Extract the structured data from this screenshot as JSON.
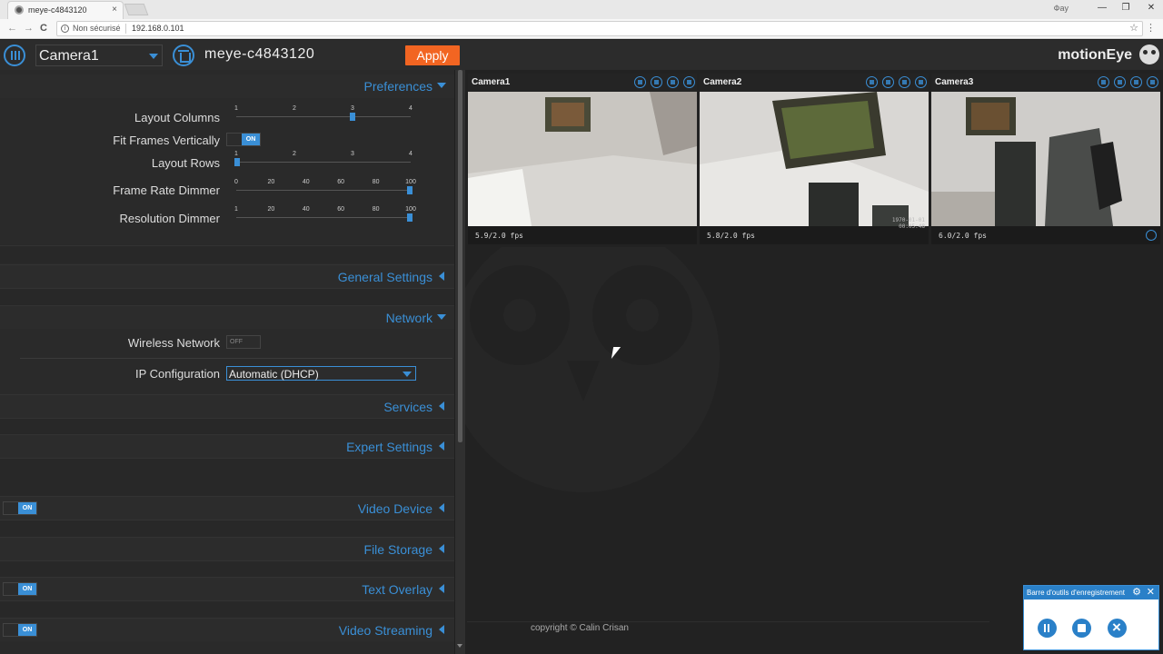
{
  "browser": {
    "tab_title": "meye-c4843120",
    "tab_close": "×",
    "user_badge": "Фay",
    "window_minimize": "—",
    "window_maximize": "❐",
    "window_close": "✕",
    "back_glyph": "←",
    "forward_glyph": "→",
    "reload_glyph": "C",
    "info_glyph": "i",
    "security_text": "Non sécurisé",
    "url": "192.168.0.101",
    "star_glyph": "☆",
    "menu_glyph": "⋮"
  },
  "header": {
    "camera_selected": "Camera1",
    "device_name": "meye-c4843120",
    "apply_label": "Apply",
    "brand": "motionEye"
  },
  "settings": {
    "preferences": {
      "title": "Preferences",
      "layout_columns": {
        "label": "Layout Columns",
        "ticks": [
          "1",
          "2",
          "3",
          "4"
        ],
        "value": 3,
        "min": 1,
        "max": 4
      },
      "fit_frames": {
        "label": "Fit Frames Vertically",
        "state": "ON"
      },
      "layout_rows": {
        "label": "Layout Rows",
        "ticks": [
          "1",
          "2",
          "3",
          "4"
        ],
        "value": 1,
        "min": 1,
        "max": 4
      },
      "frame_rate_dimmer": {
        "label": "Frame Rate Dimmer",
        "ticks": [
          "0",
          "20",
          "40",
          "60",
          "80",
          "100"
        ],
        "value": 100,
        "min": 0,
        "max": 100
      },
      "resolution_dimmer": {
        "label": "Resolution Dimmer",
        "ticks": [
          "1",
          "20",
          "40",
          "60",
          "80",
          "100"
        ],
        "value": 100,
        "min": 1,
        "max": 100
      }
    },
    "general_settings": {
      "title": "General Settings"
    },
    "network": {
      "title": "Network",
      "wireless": {
        "label": "Wireless Network",
        "state": "OFF"
      },
      "ip_config": {
        "label": "IP Configuration",
        "value": "Automatic (DHCP)"
      }
    },
    "services": {
      "title": "Services"
    },
    "expert_settings": {
      "title": "Expert Settings"
    },
    "video_device": {
      "title": "Video Device",
      "state": "ON"
    },
    "file_storage": {
      "title": "File Storage"
    },
    "text_overlay": {
      "title": "Text Overlay",
      "state": "ON"
    },
    "video_streaming": {
      "title": "Video Streaming",
      "state": "ON"
    }
  },
  "cameras": [
    {
      "name": "Camera1",
      "fps": "5.9/2.0 fps"
    },
    {
      "name": "Camera2",
      "fps": "5.8/2.0 fps",
      "overlay_text": "1970-01-01 00:05:48"
    },
    {
      "name": "Camera3",
      "fps": "6.0/2.0 fps"
    }
  ],
  "footer": {
    "copyright": "copyright © Calin Crisan"
  },
  "recording_toolbar": {
    "title": "Barre d'outils d'enregistrement",
    "gear_glyph": "⚙",
    "close_glyph": "✕"
  },
  "colors": {
    "accent": "#3a8fd6",
    "apply": "#f26522",
    "toolbar": "#2a80c8"
  }
}
